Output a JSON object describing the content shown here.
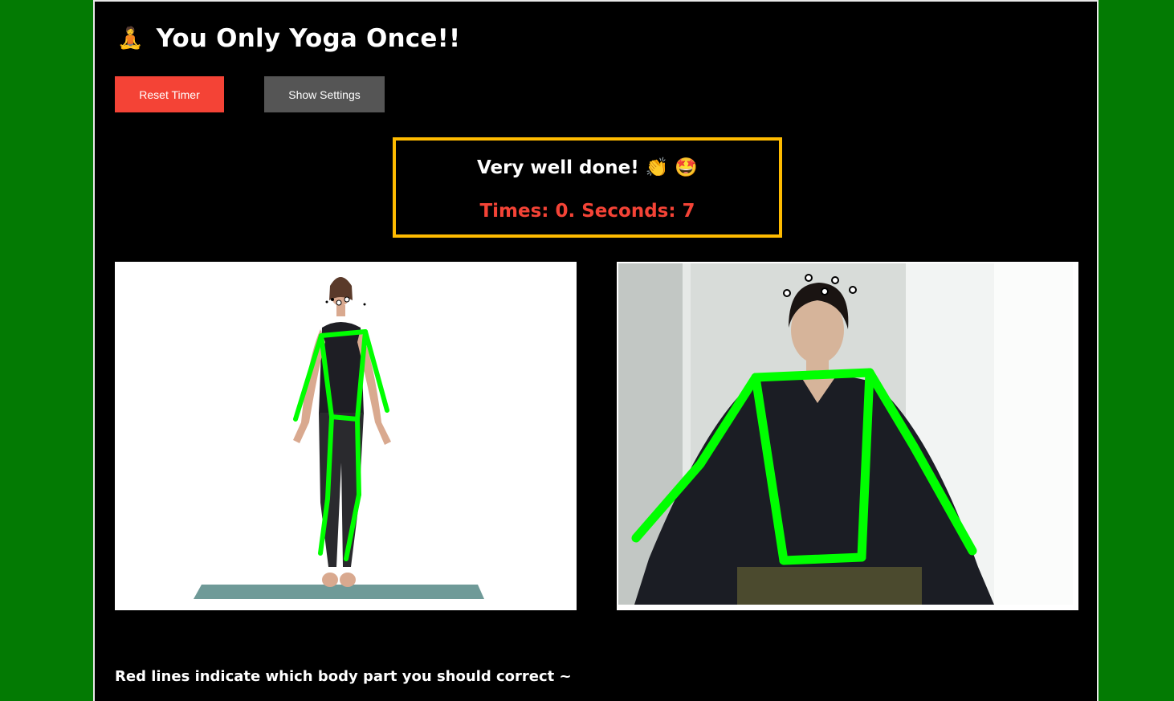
{
  "app": {
    "title": "You Only Yoga Once!!",
    "title_icon": "🧘"
  },
  "toolbar": {
    "reset_label": "Reset Timer",
    "settings_label": "Show Settings"
  },
  "feedback": {
    "message": "Very well done! 👏  🤩",
    "counter": "Times: 0. Seconds: 7"
  },
  "panels": {
    "reference": {
      "name": "reference-pose-image"
    },
    "camera": {
      "name": "webcam-feed"
    }
  },
  "hint": "Red lines indicate which body part you should correct ~",
  "colors": {
    "page_bg": "#037a03",
    "content_bg": "#000000",
    "reset_button": "#f44336",
    "settings_button": "#555555",
    "feedback_border": "#ffbb00",
    "counter_text": "#f44336",
    "skeleton_line": "#00ff00"
  }
}
